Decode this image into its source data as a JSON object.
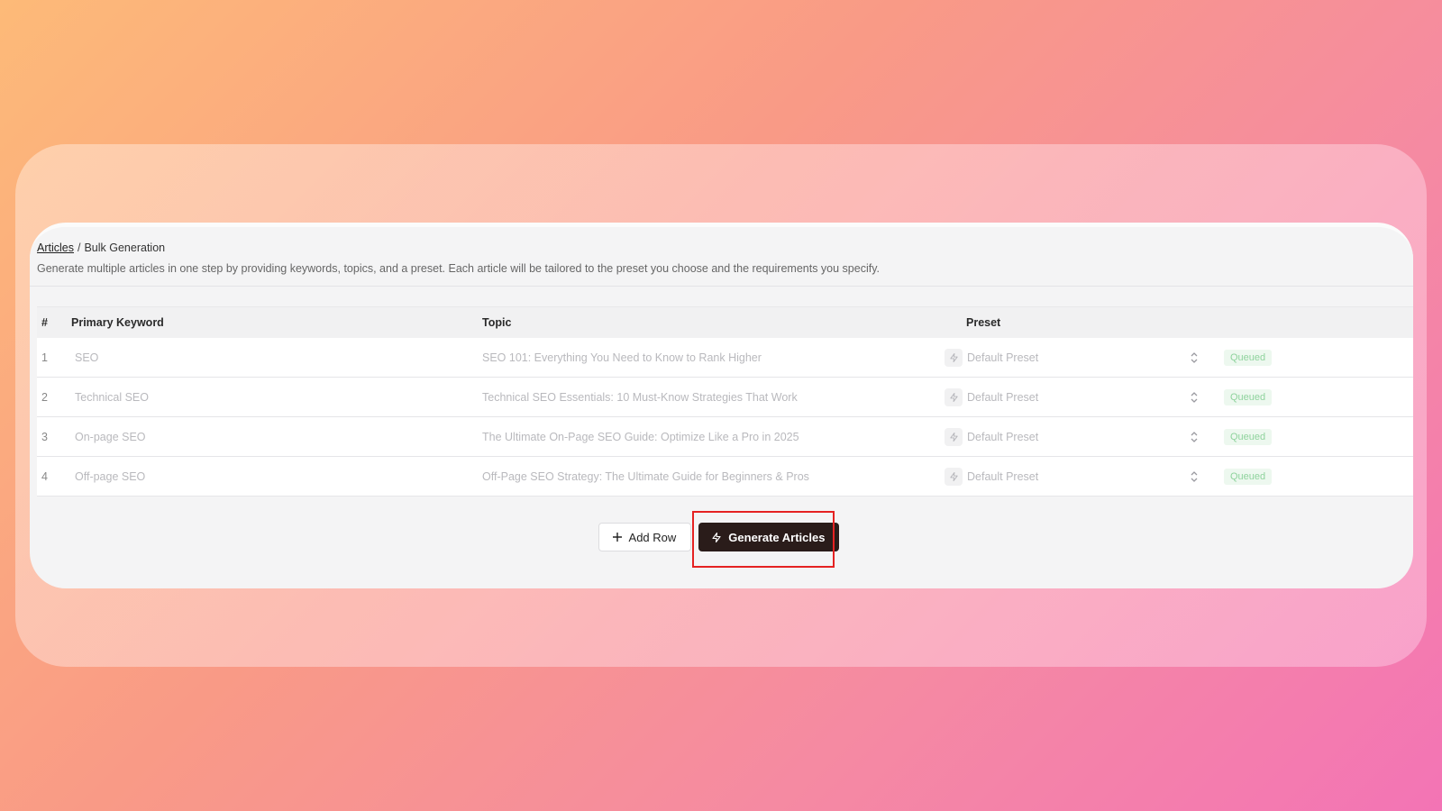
{
  "breadcrumb": {
    "parent": "Articles",
    "separator": "/",
    "current": "Bulk Generation"
  },
  "description": "Generate multiple articles in one step by providing keywords, topics, and a preset. Each article will be tailored to the preset you choose and the requirements you specify.",
  "table": {
    "headers": {
      "num": "#",
      "keyword": "Primary Keyword",
      "topic": "Topic",
      "preset": "Preset"
    },
    "rows": [
      {
        "num": "1",
        "keyword": "SEO",
        "topic": "SEO 101: Everything You Need to Know to Rank Higher",
        "preset": "Default Preset",
        "status": "Queued"
      },
      {
        "num": "2",
        "keyword": "Technical SEO",
        "topic": "Technical SEO Essentials: 10 Must-Know Strategies That Work",
        "preset": "Default Preset",
        "status": "Queued"
      },
      {
        "num": "3",
        "keyword": "On-page SEO",
        "topic": "The Ultimate On-Page SEO Guide: Optimize Like a Pro in 2025",
        "preset": "Default Preset",
        "status": "Queued"
      },
      {
        "num": "4",
        "keyword": "Off-page SEO",
        "topic": "Off-Page SEO Strategy: The Ultimate Guide for Beginners & Pros",
        "preset": "Default Preset",
        "status": "Queued"
      }
    ]
  },
  "actions": {
    "add_row": "Add Row",
    "generate": "Generate Articles"
  },
  "colors": {
    "accent_button": "#2a1c1a",
    "highlight": "#e52222",
    "badge_text": "#8fd39d",
    "badge_bg": "#edf8ef"
  },
  "icons": {
    "add": "plus-icon",
    "generate": "lightning-icon",
    "topic_action": "lightning-icon",
    "preset_select": "chevron-up-down-icon"
  }
}
